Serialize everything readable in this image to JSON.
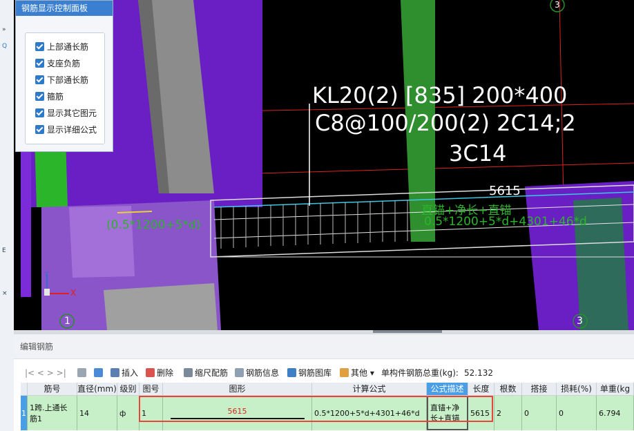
{
  "panel": {
    "title": "钢筋显示控制面板",
    "options": [
      {
        "label": "上部通长筋",
        "checked": true
      },
      {
        "label": "支座负筋",
        "checked": true
      },
      {
        "label": "下部通长筋",
        "checked": true
      },
      {
        "label": "箍筋",
        "checked": true
      },
      {
        "label": "显示其它图元",
        "checked": true
      },
      {
        "label": "显示详细公式",
        "checked": true
      }
    ]
  },
  "viewport": {
    "beam_line1": "KL20(2) [835] 200*400",
    "beam_line2": "C8@100/200(2) 2C14;2",
    "beam_line3": "3C14",
    "dim_length": "5615",
    "formula_left": "(0.5*1200+5*d)",
    "formula_right_title": "直锚+净长+直锚",
    "formula_right": "0.5*1200+5*d+4301+46*d",
    "axis_top": "3",
    "axis_bottom": "3",
    "axis_left_bottom": "1",
    "axis_x_label": "X",
    "axis_y_label": "Y",
    "colors": {
      "purple": "#6a1fc4",
      "green": "#2bb52b",
      "teal": "#2e6b5a",
      "grey": "#8c8c8c"
    }
  },
  "left_strip": {
    "glyph1": "»",
    "glyph2": "Q",
    "glyph3": "E",
    "glyph4": "×"
  },
  "editor": {
    "title": "编辑钢筋",
    "toolbar": {
      "nav": "|<   <   >   >|",
      "insert": "插入",
      "delete": "删除",
      "scale": "缩尺配筋",
      "info": "钢筋信息",
      "library": "钢筋图库",
      "other": "其他",
      "total_label": "单构件钢筋总重(kg):",
      "total_value": "52.132"
    },
    "columns": [
      "筋号",
      "直径(mm)",
      "级别",
      "图号",
      "图形",
      "计算公式",
      "公式描述",
      "长度",
      "根数",
      "搭接",
      "损耗(%)",
      "单重(kg"
    ],
    "row": {
      "index": "1",
      "name": "1跨.上通长筋1",
      "diameter": "14",
      "grade": "ф",
      "figure_no": "1",
      "shape_length": "5615",
      "formula": "0.5*1200+5*d+4301+46*d",
      "description": "直锚+净长+直锚",
      "length": "5615",
      "count": "2",
      "lap": "0",
      "loss": "0",
      "unit_weight": "6.794"
    }
  }
}
